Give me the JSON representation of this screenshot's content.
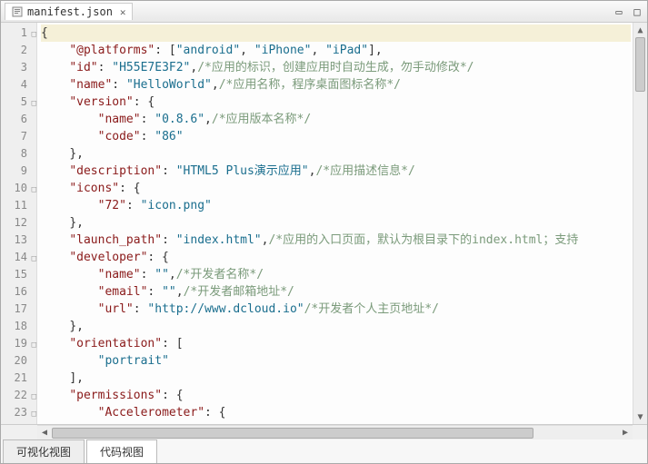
{
  "tab": {
    "filename": "manifest.json"
  },
  "bottom_tabs": {
    "visual": "可视化视图",
    "code": "代码视图"
  },
  "lines": [
    {
      "n": 1,
      "fold": true,
      "hl": true,
      "indent": 0,
      "tokens": [
        {
          "t": "pun",
          "v": "{"
        }
      ]
    },
    {
      "n": 2,
      "fold": false,
      "indent": 1,
      "tokens": [
        {
          "t": "key",
          "v": "\"@platforms\""
        },
        {
          "t": "pun",
          "v": ": ["
        },
        {
          "t": "str",
          "v": "\"android\""
        },
        {
          "t": "pun",
          "v": ", "
        },
        {
          "t": "str",
          "v": "\"iPhone\""
        },
        {
          "t": "pun",
          "v": ", "
        },
        {
          "t": "str",
          "v": "\"iPad\""
        },
        {
          "t": "pun",
          "v": "],"
        }
      ]
    },
    {
      "n": 3,
      "fold": false,
      "indent": 1,
      "tokens": [
        {
          "t": "key",
          "v": "\"id\""
        },
        {
          "t": "pun",
          "v": ": "
        },
        {
          "t": "str",
          "v": "\"H55E7E3F2\""
        },
        {
          "t": "pun",
          "v": ","
        },
        {
          "t": "cmt",
          "v": "/*应用的标识，创建应用时自动生成，勿手动修改*/"
        }
      ]
    },
    {
      "n": 4,
      "fold": false,
      "indent": 1,
      "tokens": [
        {
          "t": "key",
          "v": "\"name\""
        },
        {
          "t": "pun",
          "v": ": "
        },
        {
          "t": "str",
          "v": "\"HelloWorld\""
        },
        {
          "t": "pun",
          "v": ","
        },
        {
          "t": "cmt",
          "v": "/*应用名称，程序桌面图标名称*/"
        }
      ]
    },
    {
      "n": 5,
      "fold": true,
      "indent": 1,
      "tokens": [
        {
          "t": "key",
          "v": "\"version\""
        },
        {
          "t": "pun",
          "v": ": {"
        }
      ]
    },
    {
      "n": 6,
      "fold": false,
      "indent": 2,
      "tokens": [
        {
          "t": "key",
          "v": "\"name\""
        },
        {
          "t": "pun",
          "v": ": "
        },
        {
          "t": "str",
          "v": "\"0.8.6\""
        },
        {
          "t": "pun",
          "v": ","
        },
        {
          "t": "cmt",
          "v": "/*应用版本名称*/"
        }
      ]
    },
    {
      "n": 7,
      "fold": false,
      "indent": 2,
      "tokens": [
        {
          "t": "key",
          "v": "\"code\""
        },
        {
          "t": "pun",
          "v": ": "
        },
        {
          "t": "str",
          "v": "\"86\""
        }
      ]
    },
    {
      "n": 8,
      "fold": false,
      "indent": 1,
      "tokens": [
        {
          "t": "pun",
          "v": "},"
        }
      ]
    },
    {
      "n": 9,
      "fold": false,
      "indent": 1,
      "tokens": [
        {
          "t": "key",
          "v": "\"description\""
        },
        {
          "t": "pun",
          "v": ": "
        },
        {
          "t": "str",
          "v": "\"HTML5 Plus演示应用\""
        },
        {
          "t": "pun",
          "v": ","
        },
        {
          "t": "cmt",
          "v": "/*应用描述信息*/"
        }
      ]
    },
    {
      "n": 10,
      "fold": true,
      "indent": 1,
      "tokens": [
        {
          "t": "key",
          "v": "\"icons\""
        },
        {
          "t": "pun",
          "v": ": {"
        }
      ]
    },
    {
      "n": 11,
      "fold": false,
      "indent": 2,
      "tokens": [
        {
          "t": "key",
          "v": "\"72\""
        },
        {
          "t": "pun",
          "v": ": "
        },
        {
          "t": "str",
          "v": "\"icon.png\""
        }
      ]
    },
    {
      "n": 12,
      "fold": false,
      "indent": 1,
      "tokens": [
        {
          "t": "pun",
          "v": "},"
        }
      ]
    },
    {
      "n": 13,
      "fold": false,
      "indent": 1,
      "tokens": [
        {
          "t": "key",
          "v": "\"launch_path\""
        },
        {
          "t": "pun",
          "v": ": "
        },
        {
          "t": "str",
          "v": "\"index.html\""
        },
        {
          "t": "pun",
          "v": ","
        },
        {
          "t": "cmt",
          "v": "/*应用的入口页面，默认为根目录下的index.html；支持"
        }
      ]
    },
    {
      "n": 14,
      "fold": true,
      "indent": 1,
      "tokens": [
        {
          "t": "key",
          "v": "\"developer\""
        },
        {
          "t": "pun",
          "v": ": {"
        }
      ]
    },
    {
      "n": 15,
      "fold": false,
      "indent": 2,
      "tokens": [
        {
          "t": "key",
          "v": "\"name\""
        },
        {
          "t": "pun",
          "v": ": "
        },
        {
          "t": "str",
          "v": "\"\""
        },
        {
          "t": "pun",
          "v": ","
        },
        {
          "t": "cmt",
          "v": "/*开发者名称*/"
        }
      ]
    },
    {
      "n": 16,
      "fold": false,
      "indent": 2,
      "tokens": [
        {
          "t": "key",
          "v": "\"email\""
        },
        {
          "t": "pun",
          "v": ": "
        },
        {
          "t": "str",
          "v": "\"\""
        },
        {
          "t": "pun",
          "v": ","
        },
        {
          "t": "cmt",
          "v": "/*开发者邮箱地址*/"
        }
      ]
    },
    {
      "n": 17,
      "fold": false,
      "indent": 2,
      "tokens": [
        {
          "t": "key",
          "v": "\"url\""
        },
        {
          "t": "pun",
          "v": ": "
        },
        {
          "t": "str",
          "v": "\"http://www.dcloud.io\""
        },
        {
          "t": "cmt",
          "v": "/*开发者个人主页地址*/"
        }
      ]
    },
    {
      "n": 18,
      "fold": false,
      "indent": 1,
      "tokens": [
        {
          "t": "pun",
          "v": "},"
        }
      ]
    },
    {
      "n": 19,
      "fold": true,
      "indent": 1,
      "tokens": [
        {
          "t": "key",
          "v": "\"orientation\""
        },
        {
          "t": "pun",
          "v": ": ["
        }
      ]
    },
    {
      "n": 20,
      "fold": false,
      "indent": 2,
      "tokens": [
        {
          "t": "str",
          "v": "\"portrait\""
        }
      ]
    },
    {
      "n": 21,
      "fold": false,
      "indent": 1,
      "tokens": [
        {
          "t": "pun",
          "v": "],"
        }
      ]
    },
    {
      "n": 22,
      "fold": true,
      "indent": 1,
      "tokens": [
        {
          "t": "key",
          "v": "\"permissions\""
        },
        {
          "t": "pun",
          "v": ": {"
        }
      ]
    },
    {
      "n": 23,
      "fold": true,
      "indent": 2,
      "tokens": [
        {
          "t": "key",
          "v": "\"Accelerometer\""
        },
        {
          "t": "pun",
          "v": ": {"
        }
      ]
    }
  ]
}
